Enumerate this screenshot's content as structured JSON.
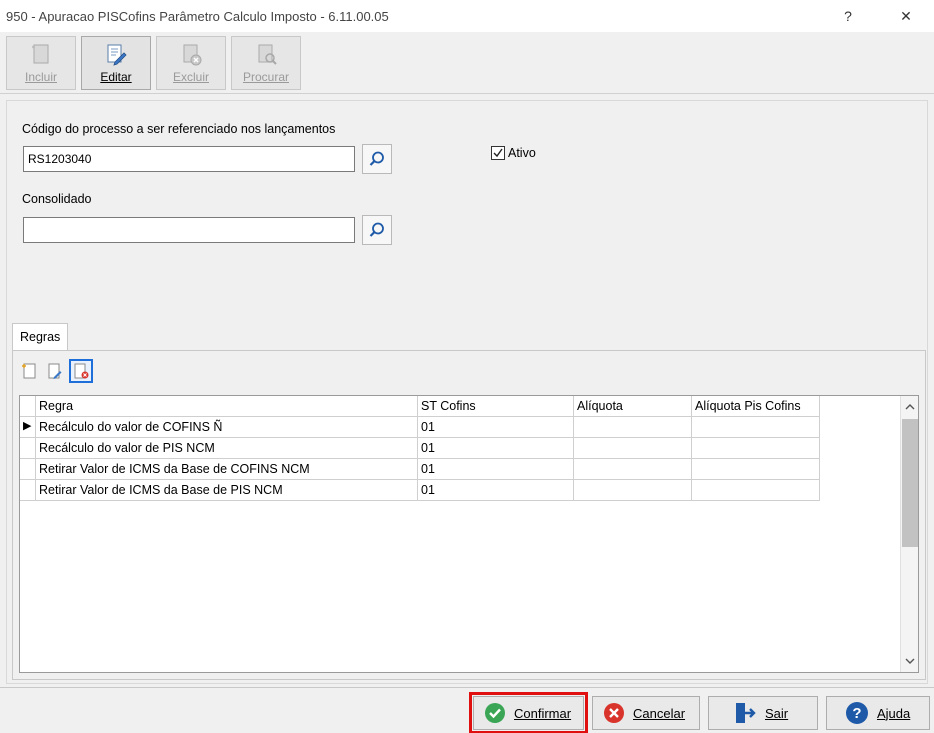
{
  "window": {
    "title": "950 - Apuracao PISCofins Parâmetro Calculo Imposto - 6.11.00.05",
    "help_glyph": "?",
    "close_glyph": "✕"
  },
  "toolbar": {
    "incluir": "Incluir",
    "editar": "Editar",
    "excluir": "Excluir",
    "procurar": "Procurar"
  },
  "form": {
    "codigo_label": "Código do processo a ser referenciado nos lançamentos",
    "codigo_value": "RS1203040",
    "consolidado_label": "Consolidado",
    "consolidado_value": "",
    "ativo_label": "Ativo",
    "ativo_checked": true
  },
  "tabs": {
    "regras": "Regras"
  },
  "grid": {
    "columns": [
      "Regra",
      "ST Cofins",
      "Alíquota",
      "Alíquota Pis Cofins"
    ],
    "rows": [
      {
        "regra": "Recálculo do valor de COFINS Ñ",
        "st": "01",
        "aliquota": "",
        "aliquota_pis": ""
      },
      {
        "regra": "Recálculo do valor de PIS NCM",
        "st": "01",
        "aliquota": "",
        "aliquota_pis": ""
      },
      {
        "regra": "Retirar Valor de ICMS da Base de COFINS NCM",
        "st": "01",
        "aliquota": "",
        "aliquota_pis": ""
      },
      {
        "regra": "Retirar Valor de ICMS da Base de PIS NCM",
        "st": "01",
        "aliquota": "",
        "aliquota_pis": ""
      }
    ],
    "current_row_marker": "▶"
  },
  "buttons": {
    "confirmar": "Confirmar",
    "cancelar": "Cancelar",
    "sair": "Sair",
    "ajuda": "Ajuda"
  },
  "colors": {
    "accent_blue": "#1e6fd9",
    "confirm_green": "#3aa655",
    "cancel_red": "#d9342b",
    "focus_red": "#e01010"
  }
}
